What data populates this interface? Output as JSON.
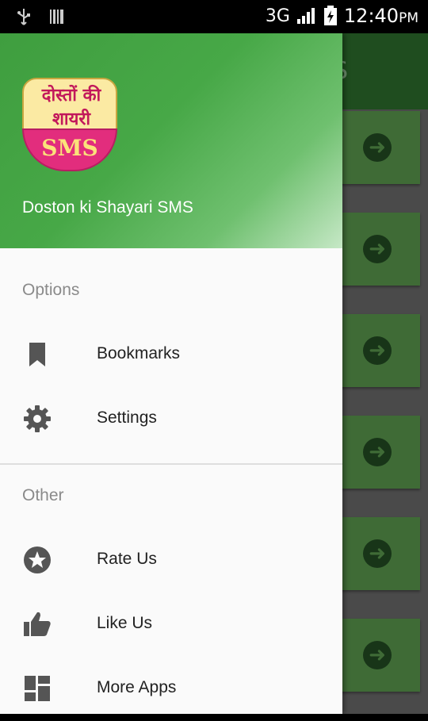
{
  "status_bar": {
    "network": "3G",
    "time": "12:40",
    "ampm": "PM"
  },
  "background_app": {
    "toolbar_fragment": "S",
    "cards_count_visible": 6
  },
  "drawer": {
    "header": {
      "logo_line1": "दोस्तों की",
      "logo_line2": "शायरी",
      "logo_badge": "SMS",
      "app_name": "Doston ki Shayari SMS"
    },
    "sections": [
      {
        "label": "Options",
        "items": [
          {
            "label": "Bookmarks",
            "icon": "bookmark-icon"
          },
          {
            "label": "Settings",
            "icon": "gear-icon"
          }
        ]
      },
      {
        "label": "Other",
        "items": [
          {
            "label": "Rate Us",
            "icon": "star-circle-icon"
          },
          {
            "label": "Like Us",
            "icon": "thumbs-up-icon"
          },
          {
            "label": "More Apps",
            "icon": "apps-grid-icon"
          }
        ]
      }
    ]
  },
  "colors": {
    "header_green": "#47a847",
    "toolbar_dark_green": "#1f4d1f",
    "card_green": "#3f6b36",
    "logo_pink": "#e22d7d",
    "logo_cream": "#fbeaa3"
  }
}
